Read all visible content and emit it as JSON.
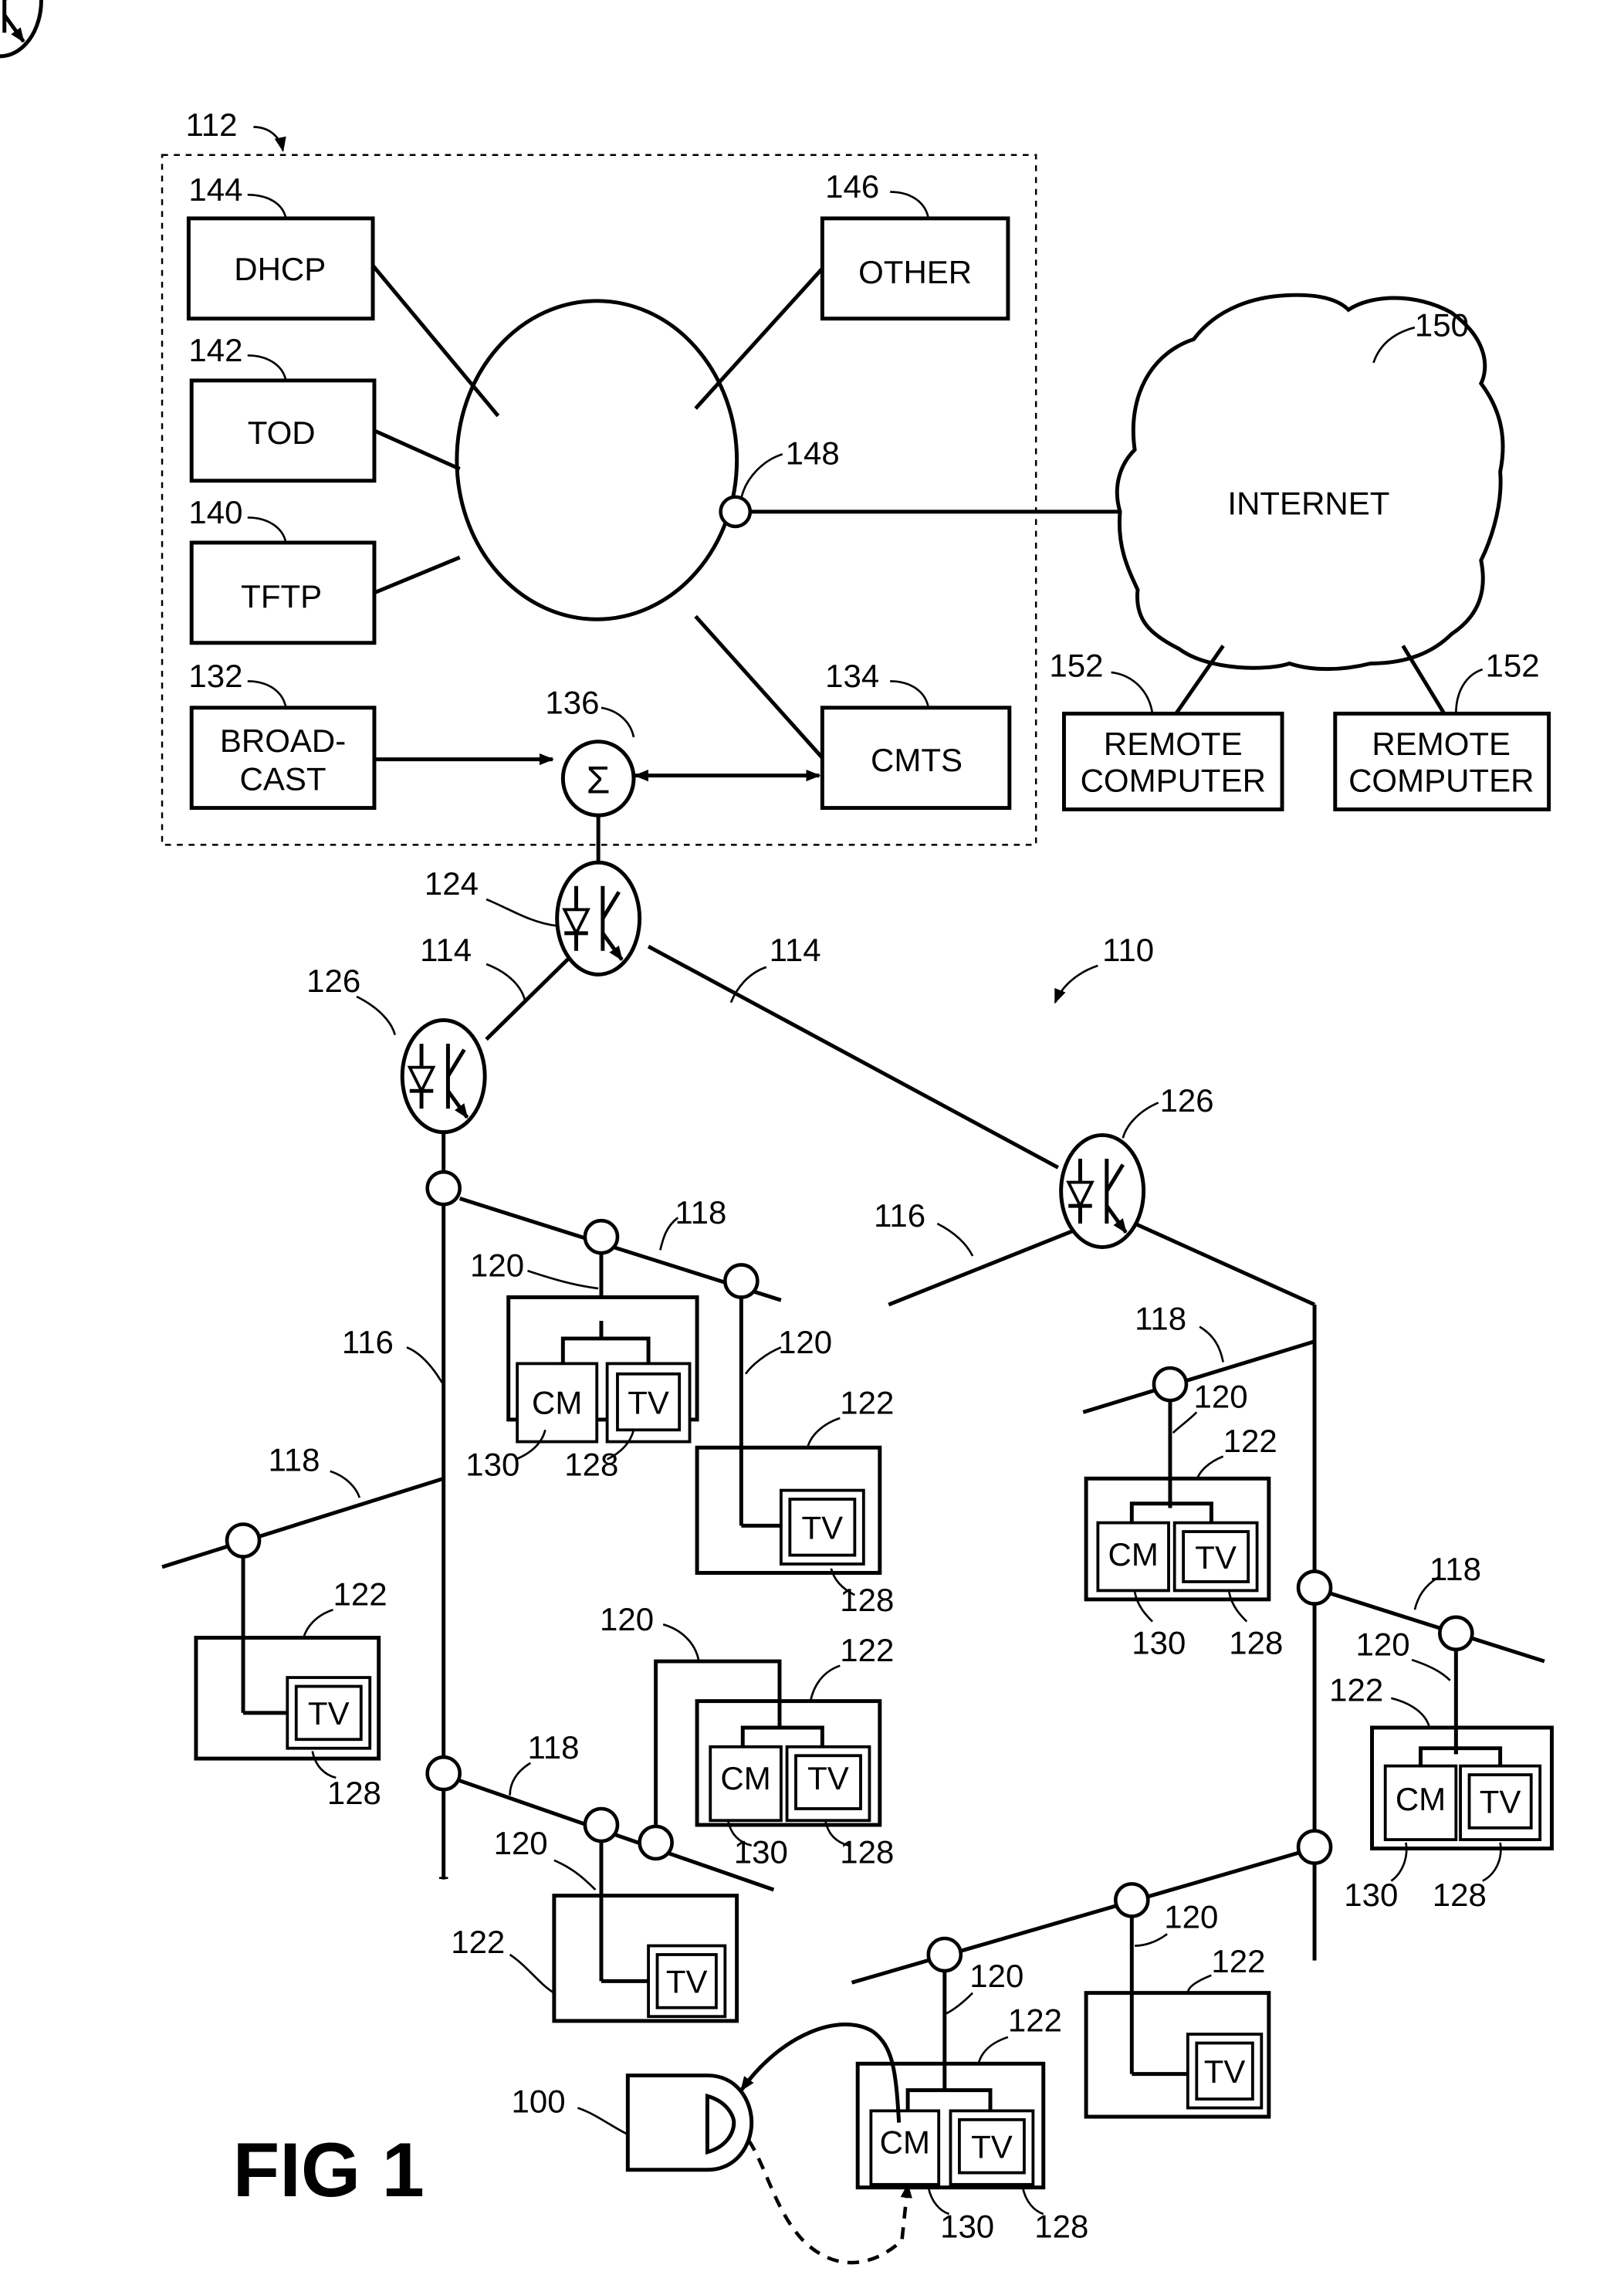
{
  "figure": {
    "title": "FIG 1",
    "system_ref": "110"
  },
  "headend": {
    "ref": "112",
    "blocks": {
      "dhcp": {
        "label": "DHCP",
        "ref": "144"
      },
      "tod": {
        "label": "TOD",
        "ref": "142"
      },
      "tftp": {
        "label": "TFTP",
        "ref": "140"
      },
      "broadcast": {
        "label1": "BROAD-",
        "label2": "CAST",
        "ref": "132"
      },
      "other": {
        "label": "OTHER",
        "ref": "146"
      },
      "cmts": {
        "label": "CMTS",
        "ref": "134"
      }
    },
    "router_port_ref": "148",
    "combiner": {
      "symbol": "Σ",
      "ref": "136"
    }
  },
  "internet": {
    "label": "INTERNET",
    "ref": "150",
    "remote_computers": [
      {
        "label1": "REMOTE",
        "label2": "COMPUTER",
        "ref": "152"
      },
      {
        "label1": "REMOTE",
        "label2": "COMPUTER",
        "ref": "152"
      }
    ]
  },
  "network": {
    "fiber_ref": "114",
    "headend_optical_node_ref": "124",
    "optical_node_ref": "126",
    "trunk_ref": "116",
    "feeder_ref": "118",
    "drop_ref": "120",
    "home_ref": "122",
    "tv_ref": "128",
    "cm_ref": "130",
    "cm_label": "CM",
    "tv_label": "TV"
  },
  "device": {
    "ref": "100",
    "symbol": "D"
  }
}
